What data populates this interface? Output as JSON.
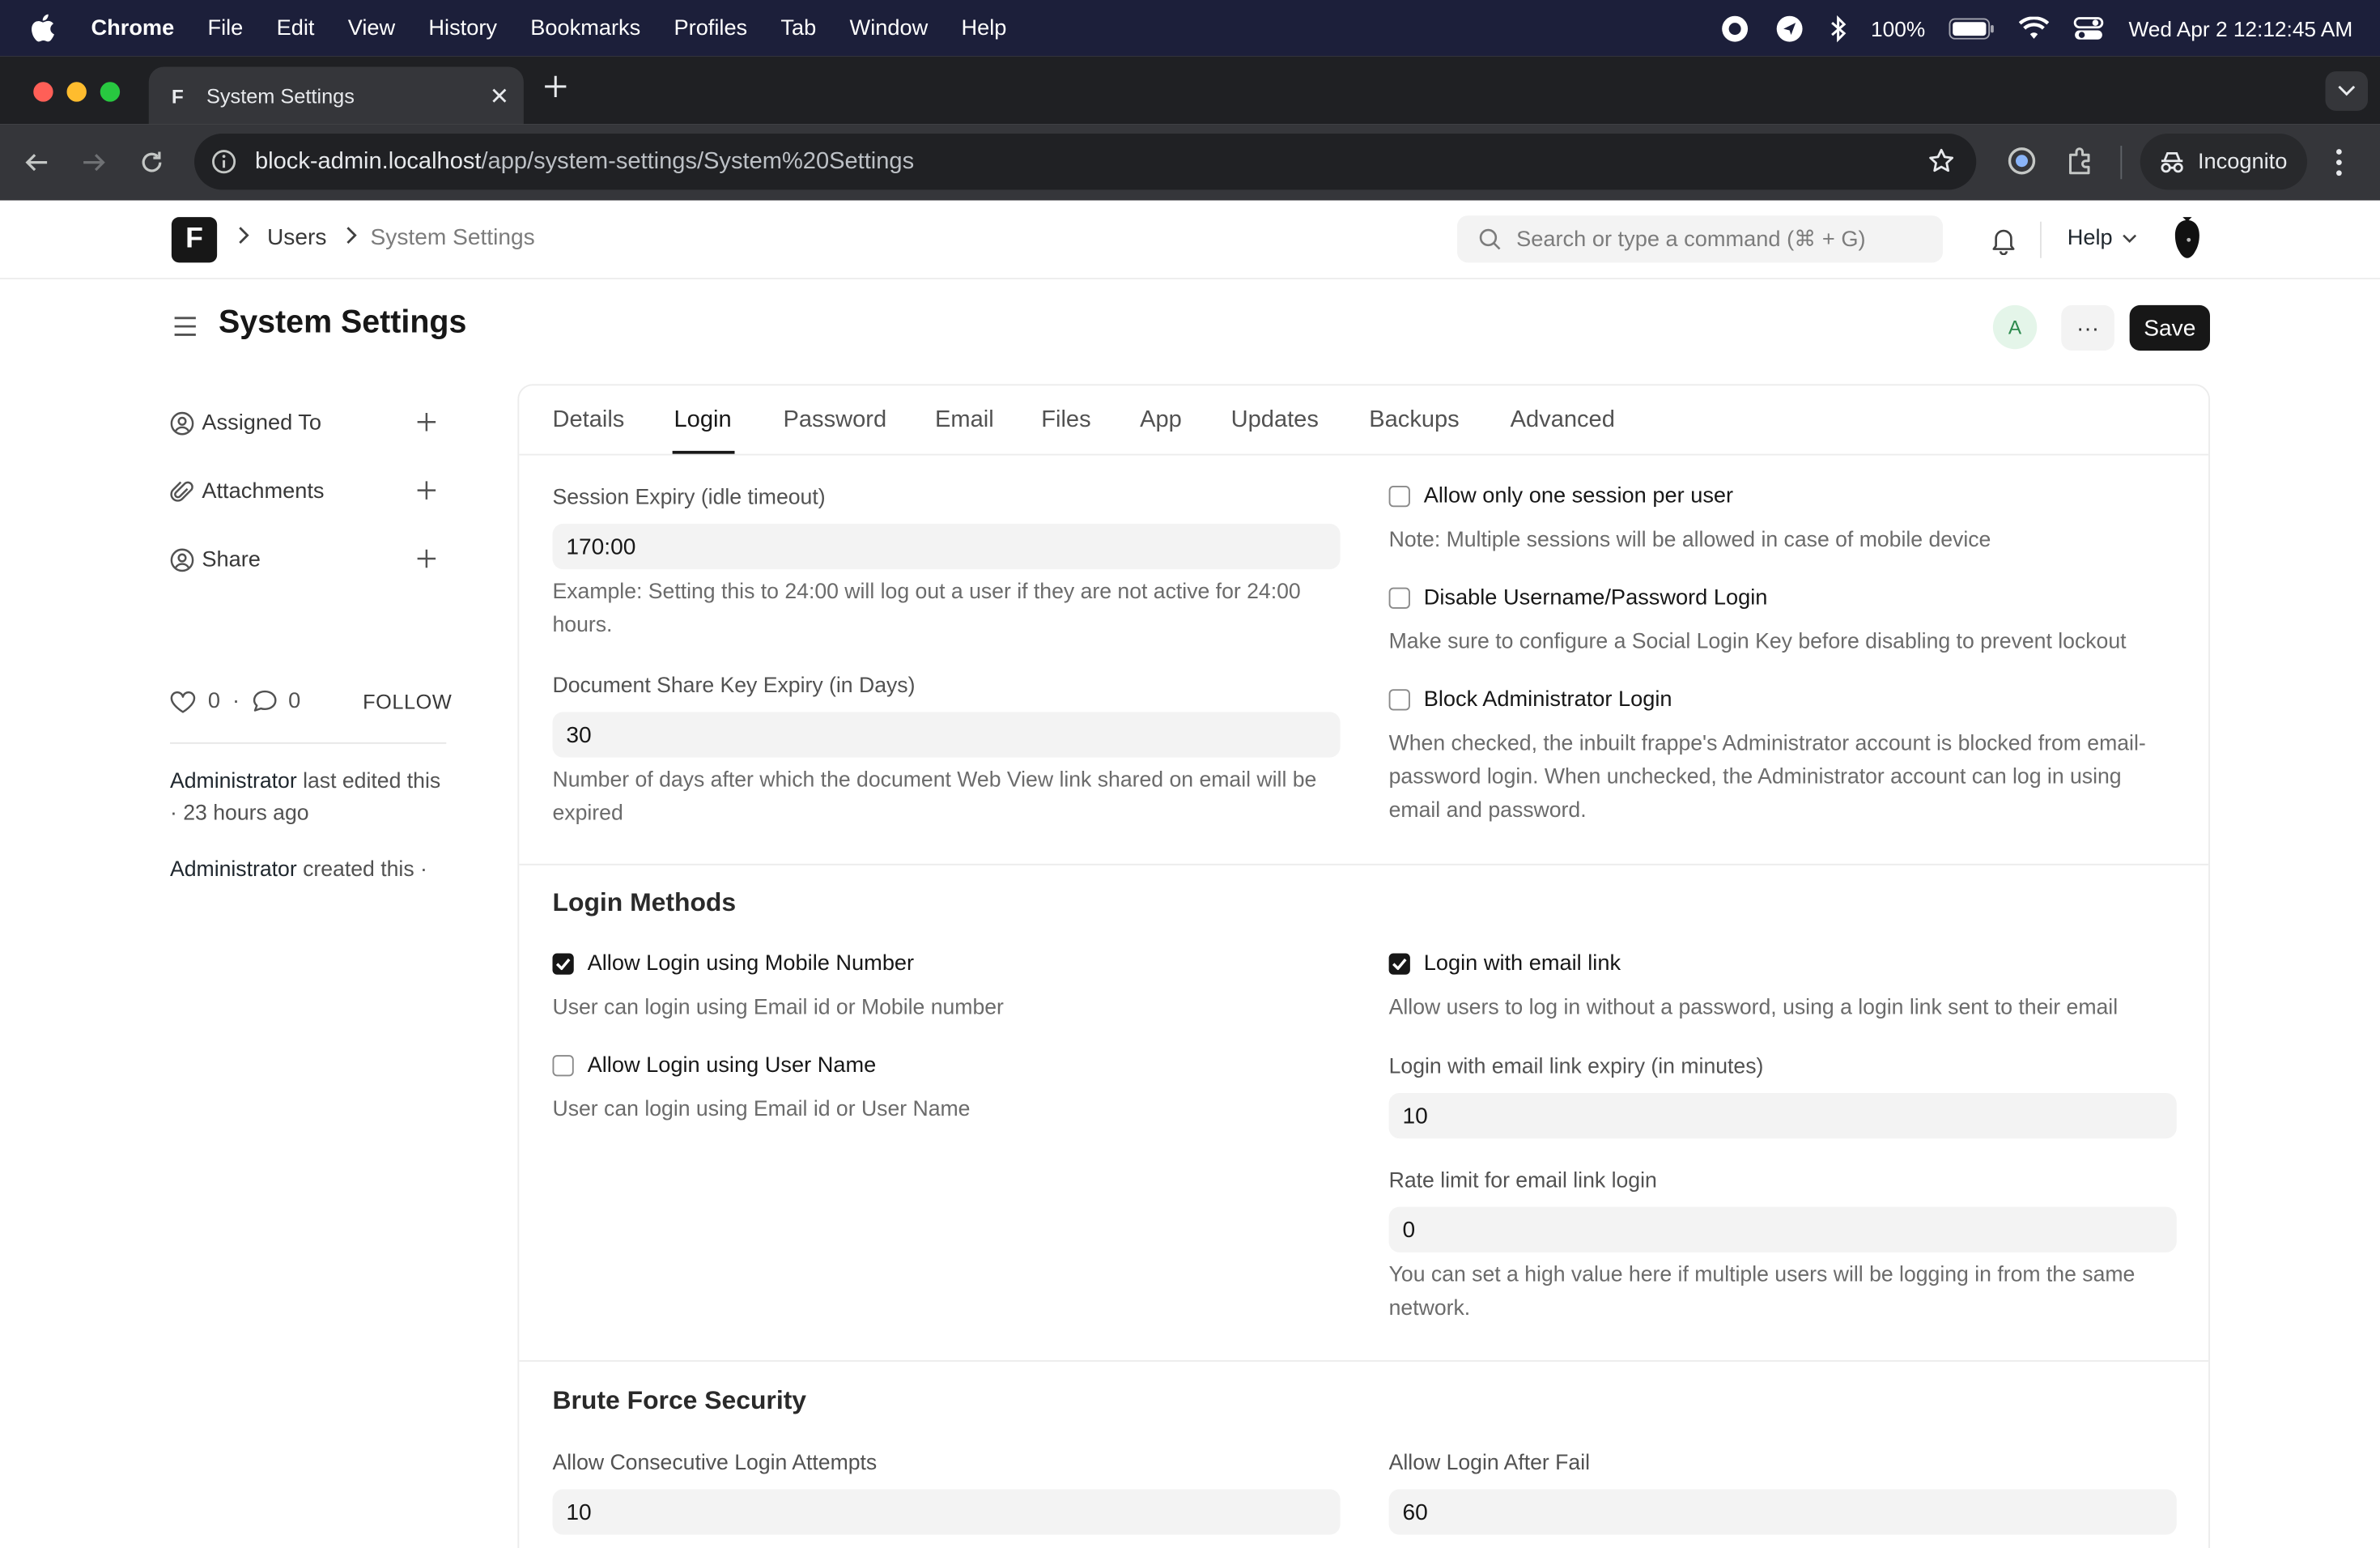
{
  "menubar": {
    "app": "Chrome",
    "items": [
      "File",
      "Edit",
      "View",
      "History",
      "Bookmarks",
      "Profiles",
      "Tab",
      "Window",
      "Help"
    ],
    "battery": "100%",
    "datetime": "Wed Apr 2  12:12:45 AM"
  },
  "browser": {
    "tab_title": "System Settings",
    "tab_favicon": "F",
    "url_host": "block-admin.localhost",
    "url_path": "/app/system-settings/System%20Settings",
    "incognito_label": "Incognito"
  },
  "appnav": {
    "logo": "F",
    "breadcrumb": [
      "Users",
      "System Settings"
    ],
    "search_placeholder": "Search or type a command (⌘ + G)",
    "help_label": "Help"
  },
  "page": {
    "title": "System Settings",
    "assigned_avatar": "A",
    "more_label": "···",
    "save_label": "Save"
  },
  "sidebar": {
    "items": [
      {
        "label": "Assigned To",
        "icon": "assign-icon"
      },
      {
        "label": "Attachments",
        "icon": "paperclip-icon"
      },
      {
        "label": "Share",
        "icon": "share-icon"
      }
    ],
    "likes": "0",
    "dot": "·",
    "comments": "0",
    "follow_label": "FOLLOW",
    "edited_user": "Administrator",
    "edited_text": " last edited this · 23 hours ago",
    "created_user": "Administrator",
    "created_text": " created this ·"
  },
  "form": {
    "tabs": [
      "Details",
      "Login",
      "Password",
      "Email",
      "Files",
      "App",
      "Updates",
      "Backups",
      "Advanced"
    ],
    "active_tab": "Login",
    "session": {
      "expiry_label": "Session Expiry (idle timeout)",
      "expiry_value": "170:00",
      "expiry_desc": "Example: Setting this to 24:00 will log out a user if they are not active for 24:00 hours.",
      "share_label": "Document Share Key Expiry (in Days)",
      "share_value": "30",
      "share_desc": "Number of days after which the document Web View link shared on email will be expired",
      "one_session_label": "Allow only one session per user",
      "one_session_checked": false,
      "one_session_desc": "Note: Multiple sessions will be allowed in case of mobile device",
      "disable_userpass_label": "Disable Username/Password Login",
      "disable_userpass_checked": false,
      "disable_userpass_desc": "Make sure to configure a Social Login Key before disabling to prevent lockout",
      "block_admin_label": "Block Administrator Login",
      "block_admin_checked": false,
      "block_admin_desc": "When checked, the inbuilt frappe's Administrator account is blocked from email-password login. When unchecked, the Administrator account can log in using email and password."
    },
    "login_methods": {
      "title": "Login Methods",
      "mobile_label": "Allow Login using Mobile Number",
      "mobile_checked": true,
      "mobile_desc": "User can login using Email id or Mobile number",
      "username_label": "Allow Login using User Name",
      "username_checked": false,
      "username_desc": "User can login using Email id or User Name",
      "email_link_label": "Login with email link",
      "email_link_checked": true,
      "email_link_desc": "Allow users to log in without a password, using a login link sent to their email",
      "link_expiry_label": "Login with email link expiry (in minutes)",
      "link_expiry_value": "10",
      "rate_limit_label": "Rate limit for email link login",
      "rate_limit_value": "0",
      "rate_limit_desc": "You can set a high value here if multiple users will be logging in from the same network."
    },
    "brute_force": {
      "title": "Brute Force Security",
      "attempts_label": "Allow Consecutive Login Attempts",
      "attempts_value": "10",
      "after_fail_label": "Allow Login After Fail",
      "after_fail_value": "60"
    }
  },
  "colors": {
    "menubar_bg": "#1c1f3a",
    "primary_button": "#171717",
    "avatar_bg": "#e4f5e9"
  }
}
